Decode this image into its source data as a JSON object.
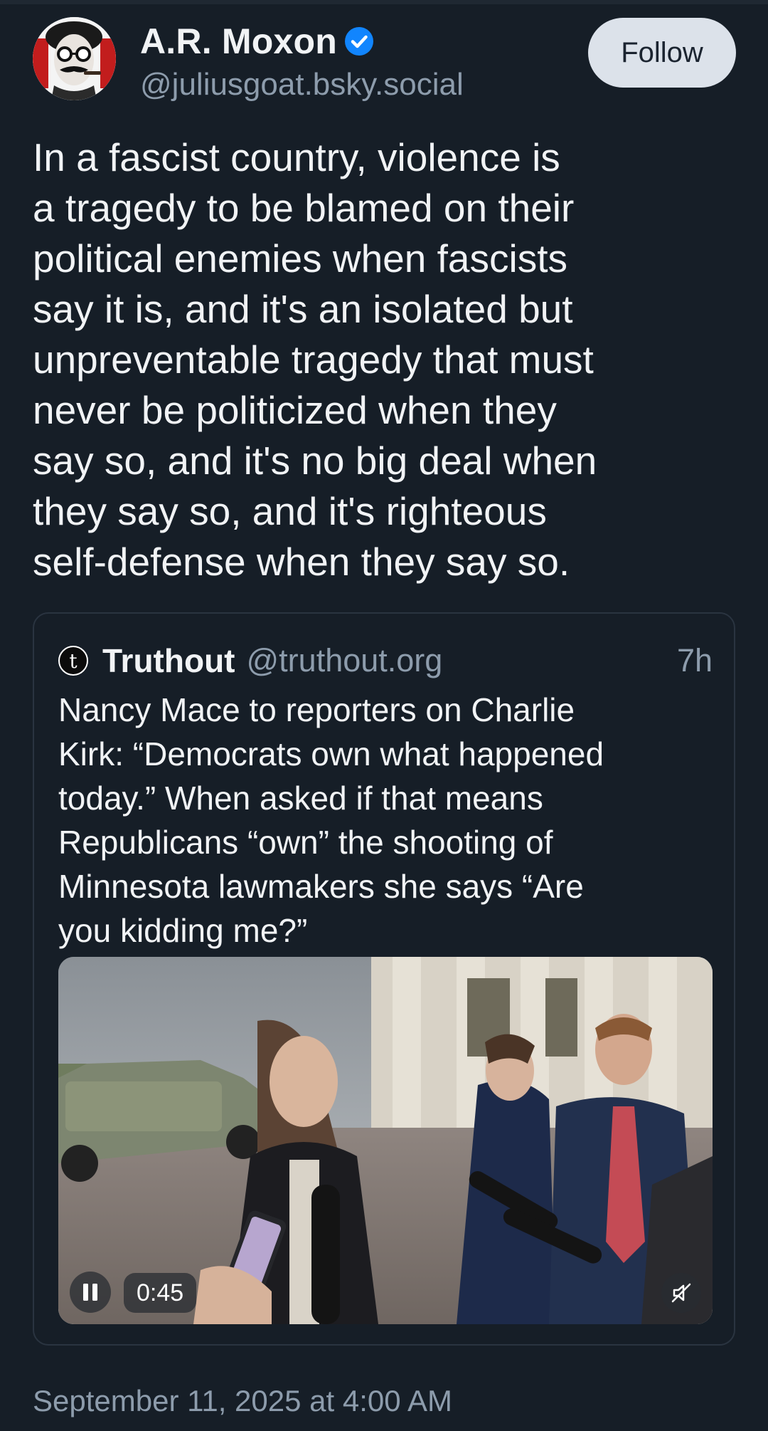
{
  "author": {
    "display_name": "A.R. Moxon",
    "handle": "@juliusgoat.bsky.social",
    "verified": true
  },
  "follow_label": "Follow",
  "post": {
    "lines": [
      "In a fascist country, violence is",
      "a tragedy to be blamed on their",
      "political enemies when fascists",
      "say it is, and it's an isolated but",
      "unpreventable tragedy that must",
      "never be politicized when they",
      "say so, and it's no big deal when",
      "they say so, and it's righteous",
      "self-defense when they say so."
    ]
  },
  "quote": {
    "avatar_letter": "t",
    "name": "Truthout",
    "handle": "@truthout.org",
    "time": "7h",
    "lines": [
      "Nancy Mace to reporters on Charlie",
      "Kirk: “Democrats own what happened",
      "today.” When asked if that means",
      "Republicans “own” the shooting of",
      "Minnesota lawmakers she says “Are",
      "you kidding me?”"
    ],
    "video": {
      "duration": "0:45"
    }
  },
  "timestamp": "September 11, 2025 at 4:00 AM",
  "colors": {
    "background": "#161e27",
    "verified_badge": "#1185fe",
    "muted_text": "#8d9cac"
  },
  "icons": {
    "verified": "verified-check-icon",
    "pause": "pause-icon",
    "mute": "speaker-muted-icon"
  }
}
